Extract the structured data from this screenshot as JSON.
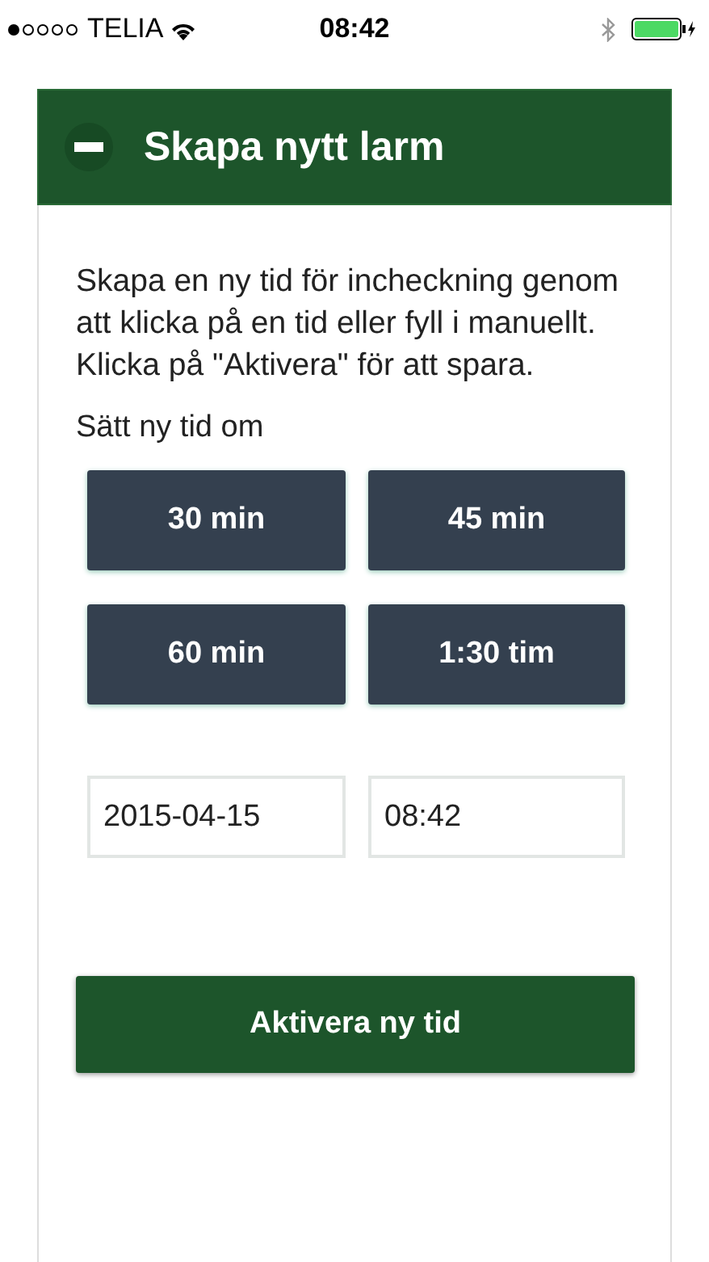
{
  "status_bar": {
    "carrier": "TELIA",
    "time": "08:42"
  },
  "panel": {
    "title": "Skapa nytt larm",
    "expanded": true,
    "description": "Skapa en ny tid för incheckning genom att klicka på en tid eller fyll i manuellt. Klicka på \"Aktivera\" för att spara.",
    "preset_label": "Sätt ny tid om",
    "presets": [
      "30 min",
      "45 min",
      "60 min",
      "1:30 tim"
    ],
    "date_field": {
      "value": "2015-04-15"
    },
    "time_field": {
      "value": "08:42"
    },
    "submit": "Aktivera ny tid"
  }
}
